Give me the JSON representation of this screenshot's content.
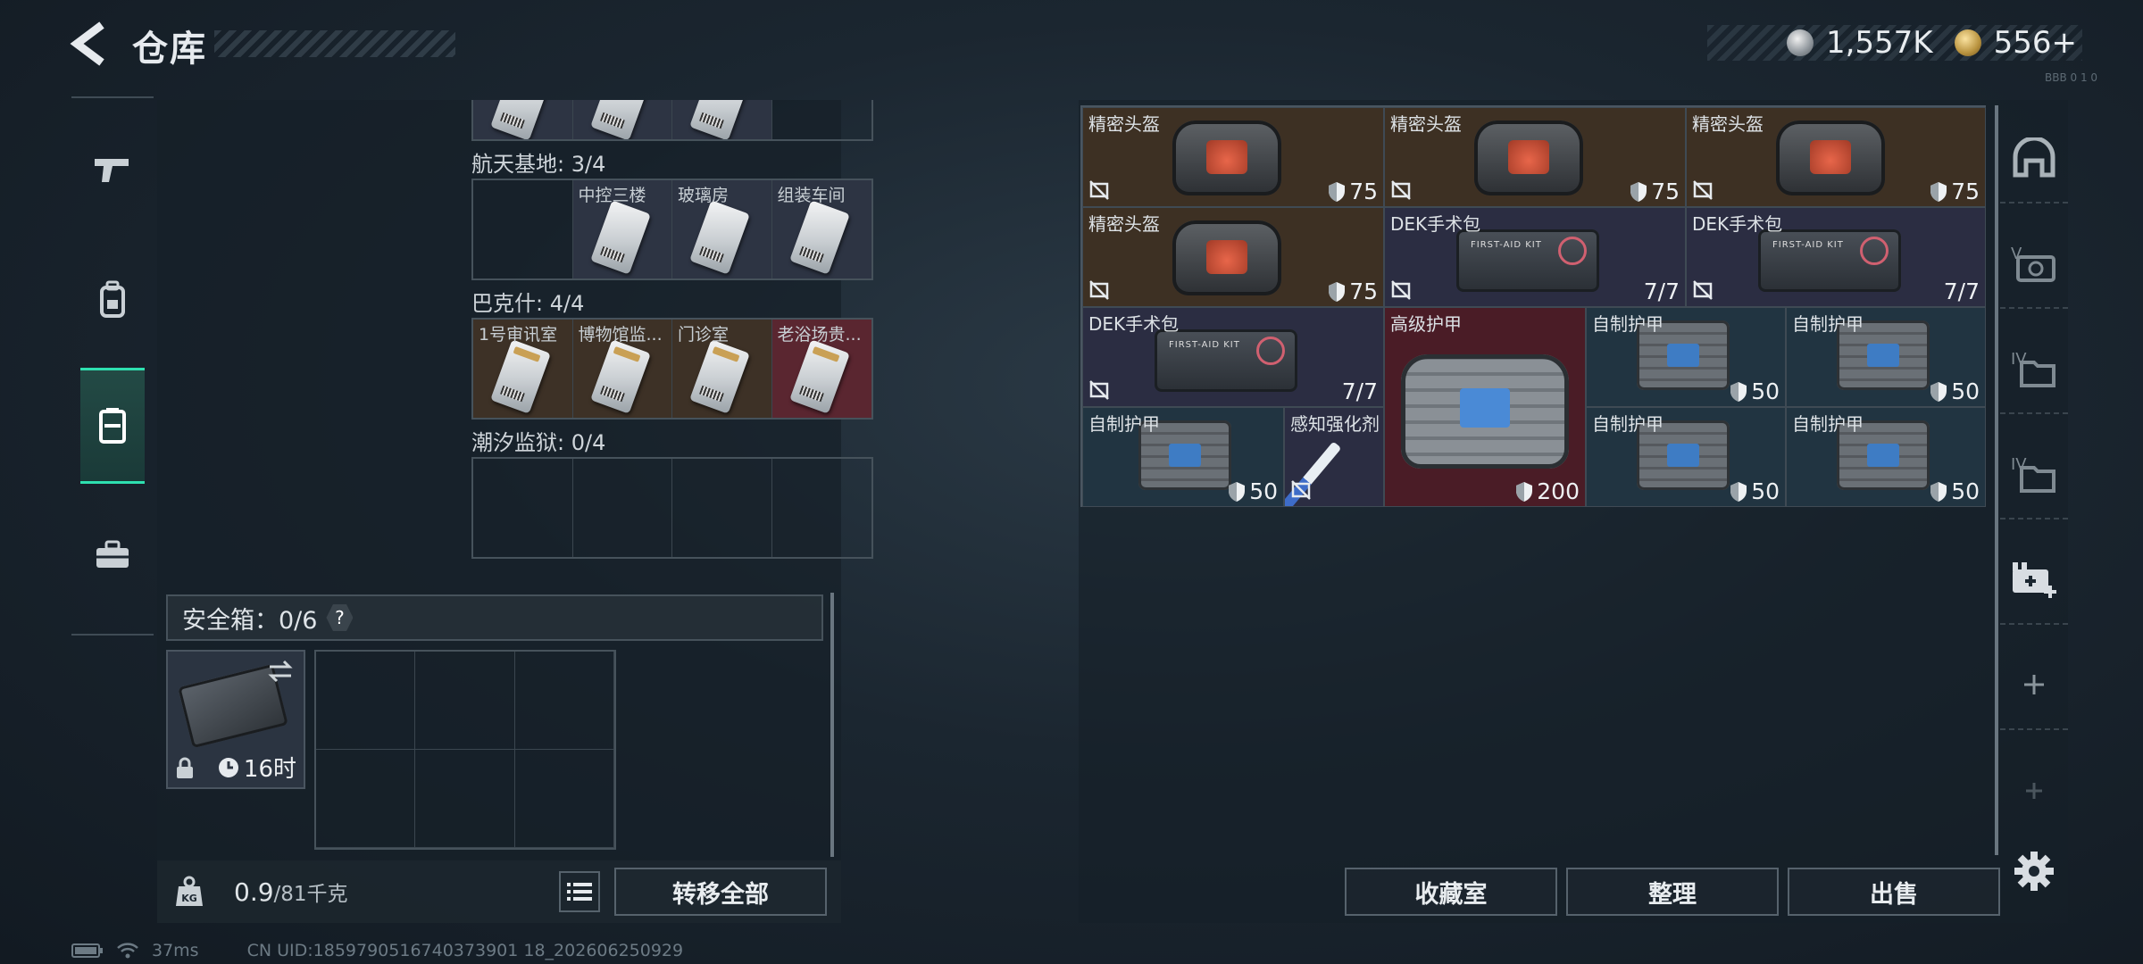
{
  "header": {
    "title": "仓库",
    "currency_silver": "1,557K",
    "currency_gold": "556+",
    "corner_tiny": "BBB 0 1 0"
  },
  "left_rail": {
    "items": [
      "weapons-tab",
      "backpack-tab",
      "container-tab",
      "toolbox-tab"
    ],
    "active": "container-tab"
  },
  "keycards": {
    "sections": [
      {
        "label": "航天基地: 3/4",
        "cells": [
          {
            "name": "",
            "filled": false
          },
          {
            "name": "中控三楼",
            "filled": true,
            "color": "filled"
          },
          {
            "name": "玻璃房",
            "filled": true,
            "color": "filled"
          },
          {
            "name": "组装车间",
            "filled": true,
            "color": "filled"
          }
        ]
      },
      {
        "label": "巴克什: 4/4",
        "cells": [
          {
            "name": "1号审讯室",
            "filled": true,
            "color": "brown"
          },
          {
            "name": "博物馆监...",
            "filled": true,
            "color": "brown"
          },
          {
            "name": "门诊室",
            "filled": true,
            "color": "brown"
          },
          {
            "name": "老浴场贵...",
            "filled": true,
            "color": "red"
          }
        ]
      },
      {
        "label": "潮汐监狱: 0/4",
        "cells": [
          {
            "name": "",
            "filled": false
          },
          {
            "name": "",
            "filled": false
          },
          {
            "name": "",
            "filled": false
          },
          {
            "name": "",
            "filled": false
          }
        ]
      }
    ]
  },
  "safe_box": {
    "title": "安全箱：0/6",
    "help": "?",
    "timer": "16时"
  },
  "footer_left": {
    "weight_value": "0.9",
    "weight_max": "/81千克",
    "transfer_all": "转移全部"
  },
  "inventory": {
    "items": [
      {
        "name": "精密头盔",
        "value": "75",
        "type": "helmet",
        "bg": "brown",
        "nodrop": true,
        "shield": true
      },
      {
        "name": "精密头盔",
        "value": "75",
        "type": "helmet",
        "bg": "brown",
        "nodrop": true,
        "shield": true
      },
      {
        "name": "精密头盔",
        "value": "75",
        "type": "helmet",
        "bg": "brown",
        "nodrop": true,
        "shield": true
      },
      {
        "name": "精密头盔",
        "value": "75",
        "type": "helmet",
        "bg": "brown",
        "nodrop": true,
        "shield": true
      },
      {
        "name": "DEK手术包",
        "value": "7/7",
        "type": "kit",
        "bg": "purple",
        "nodrop": true,
        "shield": false
      },
      {
        "name": "DEK手术包",
        "value": "7/7",
        "type": "kit",
        "bg": "purple",
        "nodrop": true,
        "shield": false
      },
      {
        "name": "DEK手术包",
        "value": "7/7",
        "type": "kit",
        "bg": "purple",
        "nodrop": true,
        "shield": false
      },
      {
        "name": "高级护甲",
        "value": "200",
        "type": "bigarmor",
        "bg": "red",
        "nodrop": false,
        "shield": true
      },
      {
        "name": "自制护甲",
        "value": "50",
        "type": "vest",
        "bg": "blue",
        "nodrop": false,
        "shield": true
      },
      {
        "name": "自制护甲",
        "value": "50",
        "type": "vest",
        "bg": "blue",
        "nodrop": false,
        "shield": true
      },
      {
        "name": "自制护甲",
        "value": "50",
        "type": "vest",
        "bg": "blue",
        "nodrop": true,
        "shield": true
      },
      {
        "name": "感知强化剂",
        "value": "",
        "type": "syringe",
        "bg": "purple",
        "nodrop": true,
        "shield": false
      },
      {
        "name": "自制护甲",
        "value": "50",
        "type": "vest",
        "bg": "blue",
        "nodrop": false,
        "shield": true
      },
      {
        "name": "自制护甲",
        "value": "50",
        "type": "vest",
        "bg": "blue",
        "nodrop": false,
        "shield": true
      }
    ]
  },
  "right_rail": {
    "items": [
      "helmet-slot-icon",
      "weapon-skin-icon",
      "folder-iv-icon",
      "folder-iv-2-icon",
      "medkit-add-icon",
      "plus-icon",
      "plus-disabled-icon"
    ]
  },
  "actions": {
    "collection": "收藏室",
    "sort": "整理",
    "sell": "出售"
  },
  "status_bar": {
    "ping": "37ms",
    "uid": "CN UID:1859790516740373901 18_202606250929"
  }
}
